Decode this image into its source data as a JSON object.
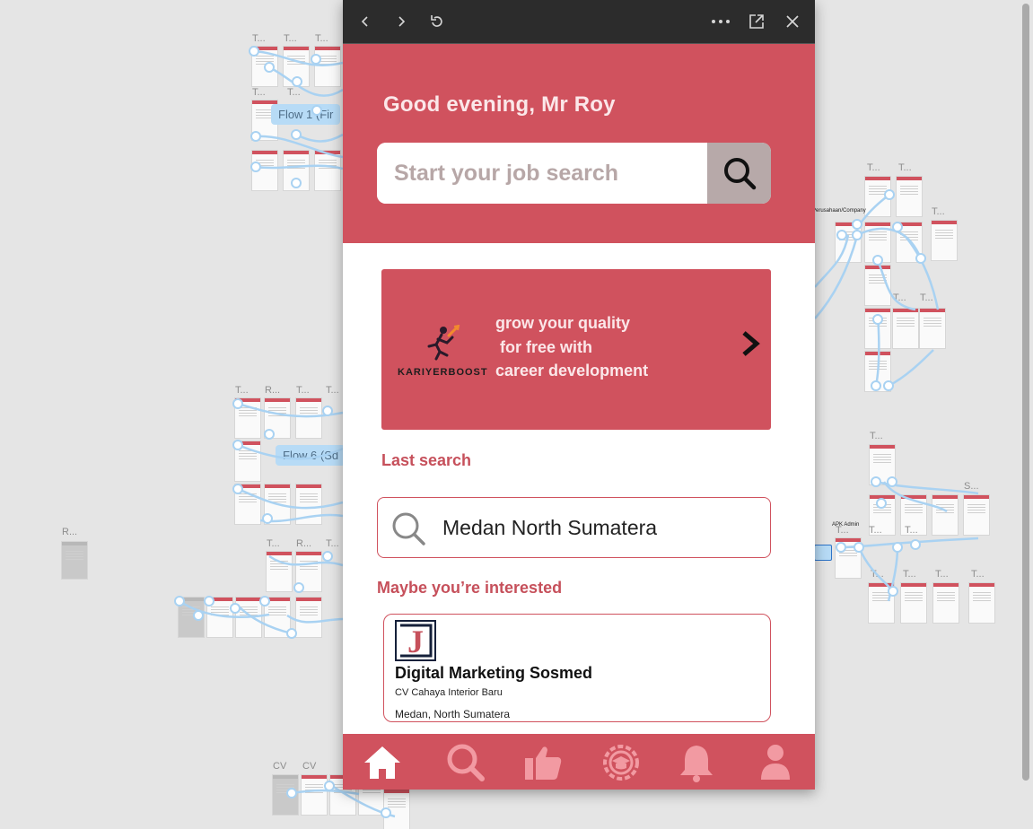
{
  "canvas": {
    "frame_label_t": "T...",
    "frame_label_r": "R...",
    "frame_label_s": "S...",
    "frame_label_cv": "CV",
    "flow_chip_1": "Flow 1 (Fir",
    "flow_chip_2": "Flow 6 (Sd",
    "company_label": "Perusahaan/Company",
    "admin_label": "APK Admin"
  },
  "window": {
    "icons": [
      "back-icon",
      "forward-icon",
      "reload-icon",
      "more-icon",
      "open-external-icon",
      "close-icon"
    ]
  },
  "header": {
    "greeting": "Good evening, Mr Roy",
    "search_placeholder": "Start your job search"
  },
  "banner": {
    "logo_text": "KARIYERBOOST",
    "text": "grow your quality\n for free with\ncareer development"
  },
  "last_search": {
    "title": "Last search",
    "query": "Medan North Sumatera"
  },
  "recommend": {
    "title": "Maybe you’re interested",
    "job": {
      "logo_letter": "J",
      "title": "Digital Marketing Sosmed",
      "company": "CV Cahaya Interior Baru",
      "location": "Medan, North Sumatera"
    }
  },
  "navbar": {
    "items": [
      "home-icon",
      "search-icon",
      "thumbs-up-icon",
      "career-badge-icon",
      "bell-icon",
      "profile-icon"
    ],
    "active": "home-icon"
  },
  "colors": {
    "brand": "#d0525e",
    "brand_text": "#fbe7e9",
    "search_button": "#b7a9a9",
    "nav_inactive": "#f29aa2",
    "titlebar": "#2c2c2c"
  }
}
